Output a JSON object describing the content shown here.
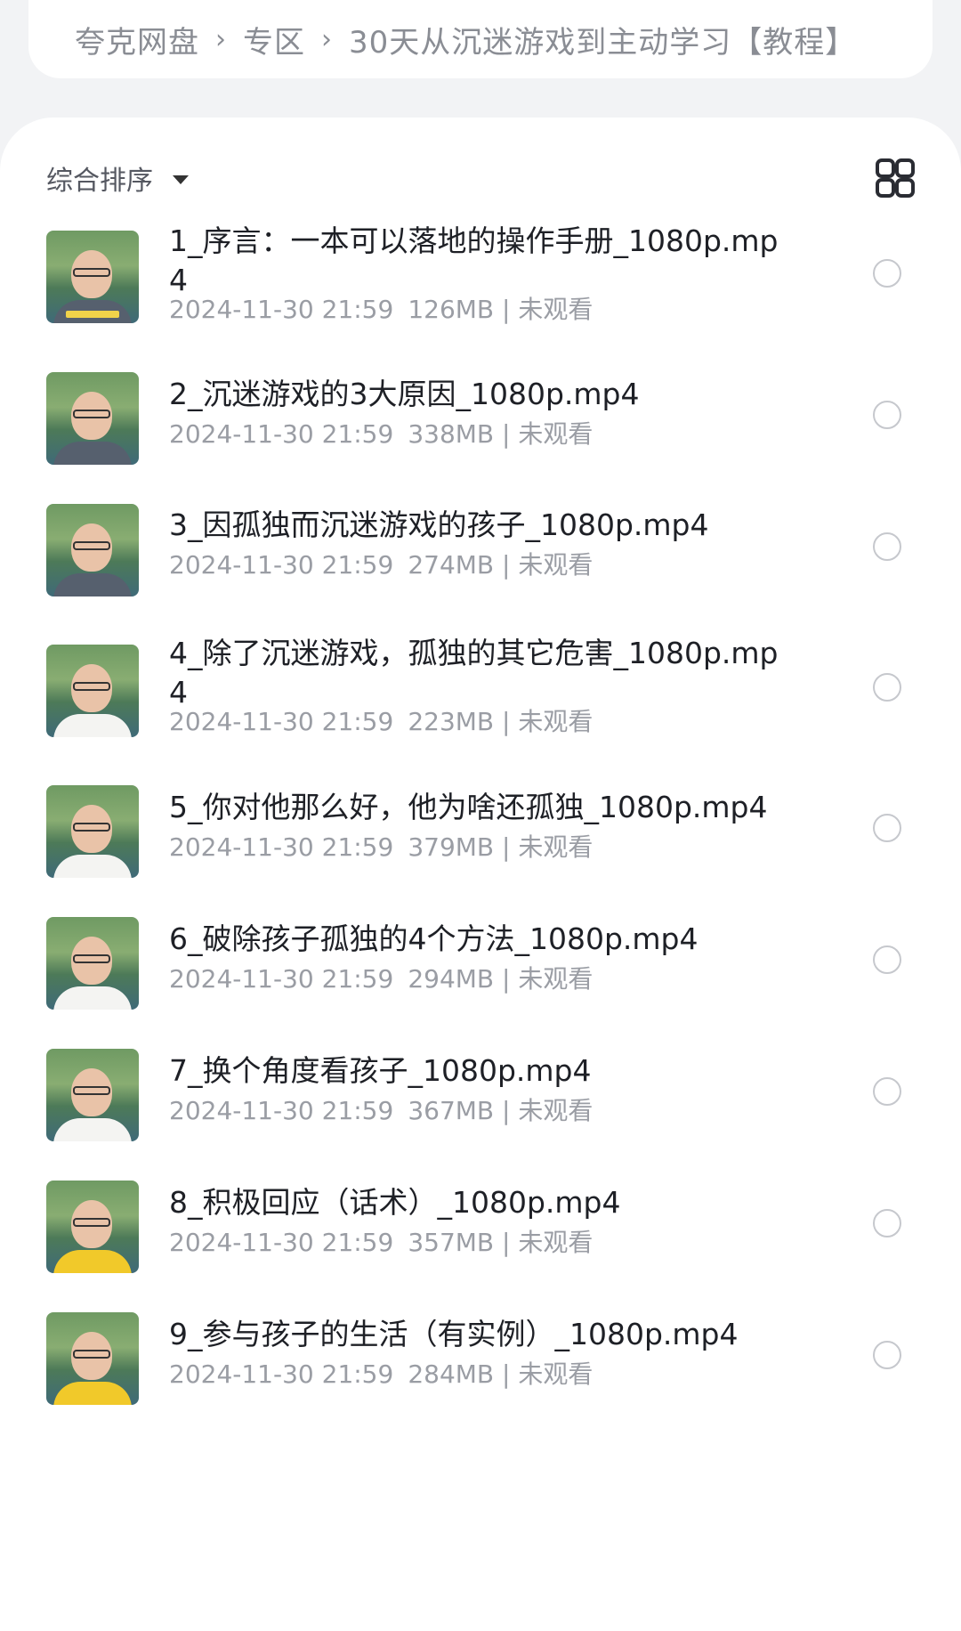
{
  "breadcrumb": [
    "夸克网盘",
    "专区",
    "30天从沉迷游戏到主动学习【教程】"
  ],
  "breadcrumb_separator": "›",
  "toolbar": {
    "sort_label": "综合排序",
    "sort_icon": "caret-down-icon",
    "view_toggle_icon": "grid-view-icon"
  },
  "files": [
    {
      "name": "1_序言：一本可以落地的操作手册_1080p.mp4",
      "date": "2024-11-30 21:59",
      "size": "126MB",
      "status": "未观看",
      "shirt": "dark"
    },
    {
      "name": "2_沉迷游戏的3大原因_1080p.mp4",
      "date": "2024-11-30 21:59",
      "size": "338MB",
      "status": "未观看",
      "shirt": "dark"
    },
    {
      "name": "3_因孤独而沉迷游戏的孩子_1080p.mp4",
      "date": "2024-11-30 21:59",
      "size": "274MB",
      "status": "未观看",
      "shirt": "dark"
    },
    {
      "name": "4_除了沉迷游戏，孤独的其它危害_1080p.mp4",
      "date": "2024-11-30 21:59",
      "size": "223MB",
      "status": "未观看",
      "shirt": "white"
    },
    {
      "name": "5_你对他那么好，他为啥还孤独_1080p.mp4",
      "date": "2024-11-30 21:59",
      "size": "379MB",
      "status": "未观看",
      "shirt": "white"
    },
    {
      "name": "6_破除孩子孤独的4个方法_1080p.mp4",
      "date": "2024-11-30 21:59",
      "size": "294MB",
      "status": "未观看",
      "shirt": "white"
    },
    {
      "name": "7_换个角度看孩子_1080p.mp4",
      "date": "2024-11-30 21:59",
      "size": "367MB",
      "status": "未观看",
      "shirt": "white"
    },
    {
      "name": "8_积极回应（话术）_1080p.mp4",
      "date": "2024-11-30 21:59",
      "size": "357MB",
      "status": "未观看",
      "shirt": "yellow"
    },
    {
      "name": "9_参与孩子的生活（有实例）_1080p.mp4",
      "date": "2024-11-30 21:59",
      "size": "284MB",
      "status": "未观看",
      "shirt": "yellow"
    }
  ]
}
